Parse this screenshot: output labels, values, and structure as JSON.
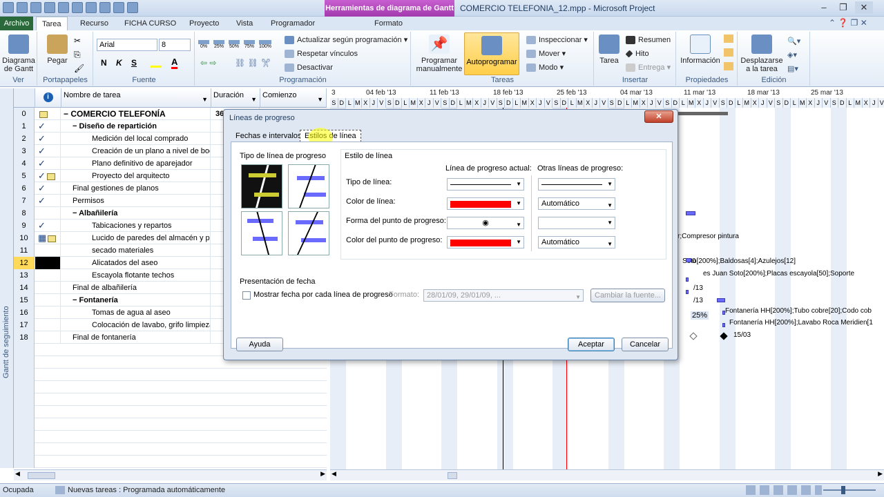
{
  "window": {
    "contextual_tab": "Herramientas de diagrama de Gantt",
    "title": "COMERCIO TELEFONIA_12.mpp - Microsoft Project",
    "minimize": "–",
    "maximize": "❐",
    "close": "✕"
  },
  "tabs": [
    "Archivo",
    "Tarea",
    "Recurso",
    "FICHA CURSO",
    "Proyecto",
    "Vista",
    "Programador",
    "Formato"
  ],
  "ribbon": {
    "ver": {
      "button": "Diagrama de Gantt",
      "label": "Ver"
    },
    "portapapeles": {
      "button": "Pegar",
      "label": "Portapapeles"
    },
    "fuente": {
      "font": "Arial",
      "size": "8",
      "bold": "N",
      "italic": "K",
      "underline": "S",
      "label": "Fuente"
    },
    "programacion": {
      "percents": [
        "0%",
        "25%",
        "50%",
        "75%",
        "100%"
      ],
      "actualizar": "Actualizar según programación",
      "respetar": "Respetar vínculos",
      "desactivar": "Desactivar",
      "label": "Programación"
    },
    "tareas": {
      "manual": "Programar manualmente",
      "auto": "Autoprogramar",
      "inspeccionar": "Inspeccionar",
      "mover": "Mover",
      "modo": "Modo",
      "label": "Tareas"
    },
    "insertar": {
      "tarea": "Tarea",
      "resumen": "Resumen",
      "hito": "Hito",
      "entrega": "Entrega",
      "label": "Insertar"
    },
    "propiedades": {
      "informacion": "Información",
      "label": "Propiedades"
    },
    "edicion": {
      "desplazarse": "Desplazarse a la tarea",
      "label": "Edición"
    }
  },
  "side_label": "Gantt de seguimiento",
  "grid": {
    "headers": {
      "nombre": "Nombre de tarea",
      "duracion": "Duración",
      "comienzo": "Comienzo"
    },
    "rows": [
      {
        "id": "0",
        "ind": "note",
        "name": "COMERCIO TELEFONÍA",
        "dur": "36",
        "level": 0,
        "summary": true
      },
      {
        "id": "1",
        "ind": "check",
        "name": "Diseño de repartición",
        "dur": "",
        "level": 1,
        "summary": true
      },
      {
        "id": "2",
        "ind": "check",
        "name": "Medición del local comprado",
        "dur": "",
        "level": 2
      },
      {
        "id": "3",
        "ind": "check",
        "name": "Creación de un plano a nivel de bocet",
        "dur": "",
        "level": 2
      },
      {
        "id": "4",
        "ind": "check",
        "name": "Plano definitivo de aparejador",
        "dur": "",
        "level": 2
      },
      {
        "id": "5",
        "ind": "check-note",
        "name": "Proyecto del arquitecto",
        "dur": "",
        "level": 2
      },
      {
        "id": "6",
        "ind": "check",
        "name": "Final gestiones de planos",
        "dur": "",
        "level": 1
      },
      {
        "id": "7",
        "ind": "check",
        "name": "Permisos",
        "dur": "",
        "level": 1
      },
      {
        "id": "8",
        "ind": "",
        "name": "Albañilería",
        "dur": "",
        "level": 1,
        "summary": true
      },
      {
        "id": "9",
        "ind": "check",
        "name": "Tabicaciones y repartos",
        "dur": "",
        "level": 2
      },
      {
        "id": "10",
        "ind": "table-note",
        "name": "Lucido de paredes del almacén y pint",
        "dur": "",
        "level": 2
      },
      {
        "id": "11",
        "ind": "",
        "name": "secado materiales",
        "dur": "",
        "level": 2
      },
      {
        "id": "12",
        "ind": "",
        "name": "Alicatados del aseo",
        "dur": "",
        "level": 2
      },
      {
        "id": "13",
        "ind": "",
        "name": "Escayola flotante techos",
        "dur": "",
        "level": 2
      },
      {
        "id": "14",
        "ind": "",
        "name": "Final de albañilería",
        "dur": "",
        "level": 1
      },
      {
        "id": "15",
        "ind": "",
        "name": "Fontanería",
        "dur": "",
        "level": 1,
        "summary": true
      },
      {
        "id": "16",
        "ind": "",
        "name": "Tomas de agua al aseo",
        "dur": "",
        "level": 2
      },
      {
        "id": "17",
        "ind": "",
        "name": "Colocación de lavabo, grifo limpieza e",
        "dur": "",
        "level": 2
      },
      {
        "id": "18",
        "ind": "",
        "name": "Final de fontanería",
        "dur": "",
        "level": 1
      }
    ]
  },
  "timescale": {
    "weeks": [
      "3",
      "04 feb '13",
      "11 feb '13",
      "18 feb '13",
      "25 feb '13",
      "04 mar '13",
      "11 mar '13",
      "18 mar '13",
      "25 mar '13"
    ],
    "day_letters": [
      "L",
      "M",
      "X",
      "J",
      "V",
      "S",
      "D"
    ]
  },
  "chart_labels": {
    "compresor": "r;Compresor pintura",
    "soto": "Soto[200%];Baldosas[4];Azulejos[12]",
    "juan": "es Juan Soto[200%];Placas escayola[50];Soporte",
    "d13a": "/13",
    "d13b": "/13",
    "zero": "0",
    "pct": "25%",
    "fontaneria1": "Fontanería HH[200%];Tubo cobre[20];Codo cob",
    "fontaneria2": "Fontanería HH[200%];Lavabo Roca Meridien[1",
    "d1503": "15/03"
  },
  "dialog": {
    "title": "Líneas de progreso",
    "close": "✕",
    "tabs": [
      "Fechas e intervalos",
      "Estilos de línea"
    ],
    "tipo_label": "Tipo de línea de progreso",
    "estilo_label": "Estilo de línea",
    "actual_header": "Línea de progreso actual:",
    "otras_header": "Otras líneas de progreso:",
    "rows": {
      "tipo": "Tipo de línea:",
      "color": "Color de línea:",
      "forma": "Forma del punto de progreso:",
      "color_punto": "Color del punto de progreso:"
    },
    "automatico": "Automático",
    "forma_symbol": "◉",
    "presentacion_label": "Presentación de fecha",
    "mostrar_fecha": "Mostrar fecha por cada línea de progreso",
    "formato_label": "Formato:",
    "formato_value": "28/01/09, 29/01/09, ...",
    "cambiar_fuente": "Cambiar la fuente...",
    "ayuda": "Ayuda",
    "aceptar": "Aceptar",
    "cancelar": "Cancelar",
    "line_color": "#ff0000"
  },
  "status": {
    "mode": "Ocupada",
    "new_tasks": "Nuevas tareas : Programada automáticamente"
  }
}
